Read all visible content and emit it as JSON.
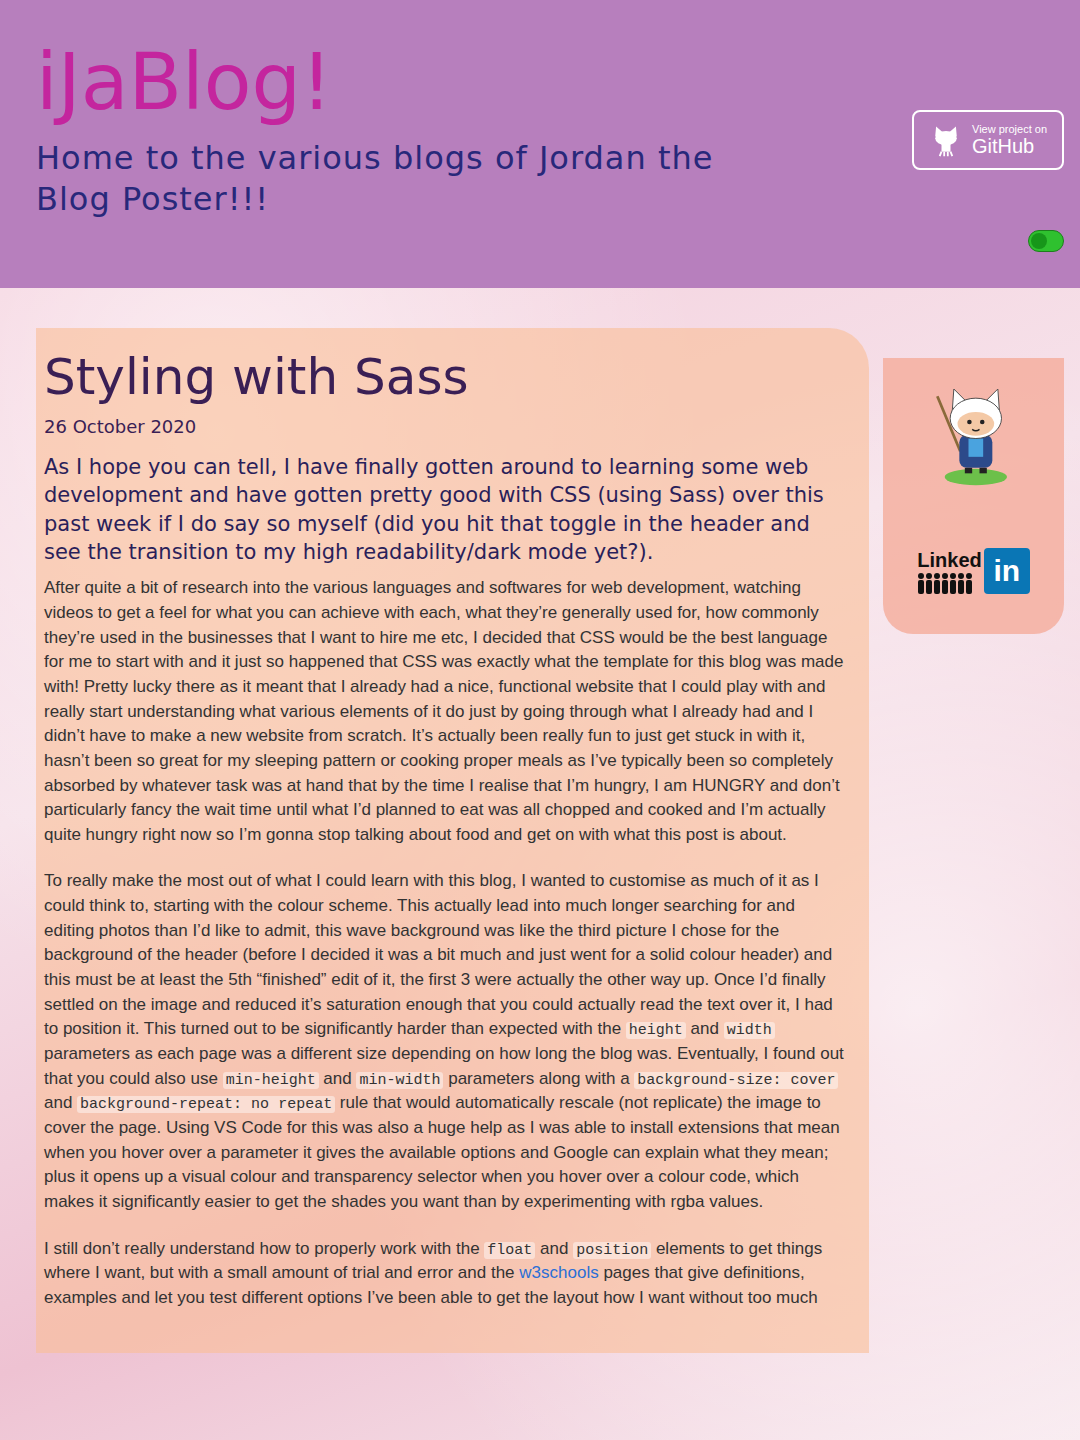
{
  "header": {
    "title": "iJaBlog!",
    "tagline": "Home to the various blogs of Jordan the Blog Poster!!!",
    "github_button": {
      "caption": "View project on",
      "label": "GitHub"
    },
    "theme_toggle": {
      "on": false,
      "color": "#2fc12f"
    }
  },
  "post": {
    "title": "Styling with Sass",
    "date": "26 October 2020",
    "intro": "As I hope you can tell, I have finally gotten around to learning some web development and have gotten pretty good with CSS (using Sass) over this past week if I do say so myself (did you hit that toggle in the header and see the transition to my high readability/dark mode yet?).",
    "paragraphs": [
      [
        {
          "kind": "text",
          "text": "After quite a bit of research into the various languages and softwares for web development, watching videos to get a feel for what you can achieve with each, what they’re generally used for, how commonly they’re used in the businesses that I want to hire me etc, I decided that CSS would be the best language for me to start with and it just so happened that CSS was exactly what the template for this blog was made with! Pretty lucky there as it meant that I already had a nice, functional website that I could play with and really start understanding what various elements of it do just by going through what I already had and I didn’t have to make a new website from scratch. It’s actually been really fun to just get stuck in with it, hasn’t been so great for my sleeping pattern or cooking proper meals as I’ve typically been so completely absorbed by whatever task was at hand that by the time I realise that I’m hungry, I am HUNGRY and don’t particularly fancy the wait time until what I’d planned to eat was all chopped and cooked and I’m actually quite hungry right now so I’m gonna stop talking about food and get on with what this post is about."
        }
      ],
      [
        {
          "kind": "text",
          "text": "To really make the most out of what I could learn with this blog, I wanted to customise as much of it as I could think to, starting with the colour scheme. This actually lead into much longer searching for and editing photos than I’d like to admit, this wave background was like the third picture I chose for the background of the header (before I decided it was a bit much and just went for a solid colour header) and this must be at least the 5th “finished” edit of it, the first 3 were actually the other way up. Once I’d finally settled on the image and reduced it’s saturation enough that you could actually read the text over it, I had to position it. This turned out to be significantly harder than expected with the "
        },
        {
          "kind": "code",
          "text": "height"
        },
        {
          "kind": "text",
          "text": " and "
        },
        {
          "kind": "code",
          "text": "width"
        },
        {
          "kind": "text",
          "text": " parameters as each page was a different size depending on how long the blog was. Eventually, I found out that you could also use "
        },
        {
          "kind": "code",
          "text": "min-height"
        },
        {
          "kind": "text",
          "text": " and "
        },
        {
          "kind": "code",
          "text": "min-width"
        },
        {
          "kind": "text",
          "text": " parameters along with a "
        },
        {
          "kind": "code",
          "text": "background-size: cover"
        },
        {
          "kind": "text",
          "text": " and "
        },
        {
          "kind": "code",
          "text": "background-repeat: no repeat"
        },
        {
          "kind": "text",
          "text": " rule that would automatically rescale (not replicate) the image to cover the page. Using VS Code for this was also a huge help as I was able to install extensions that mean when you hover over a parameter it gives the available options and Google can explain what they mean; plus it opens up a visual colour and transparency selector when you hover over a colour code, which makes it significantly easier to get the shades you want than by experimenting with rgba values."
        }
      ],
      [
        {
          "kind": "text",
          "text": "I still don’t really understand how to properly work with the "
        },
        {
          "kind": "code",
          "text": "float"
        },
        {
          "kind": "text",
          "text": " and "
        },
        {
          "kind": "code",
          "text": "position"
        },
        {
          "kind": "text",
          "text": " elements to get things where I want, but with a small amount of trial and error and the "
        },
        {
          "kind": "link",
          "text": "w3schools"
        },
        {
          "kind": "text",
          "text": " pages that give definitions, examples and let you test different options I’ve been able to get the layout how I want without too much"
        }
      ]
    ]
  },
  "sidebar": {
    "linkedin": {
      "word": "Linked",
      "badge": "in"
    }
  }
}
